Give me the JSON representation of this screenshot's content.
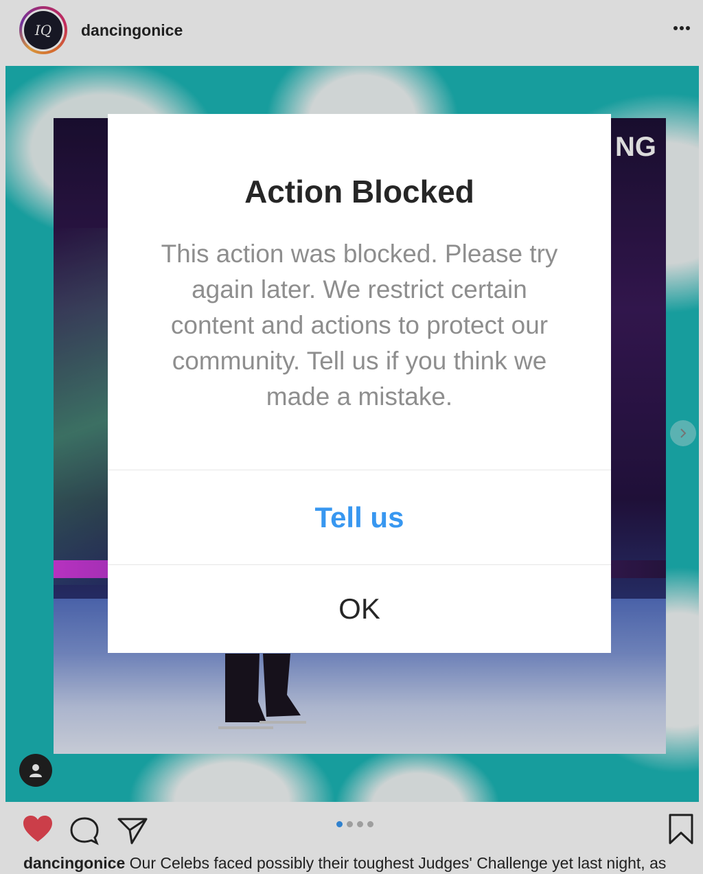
{
  "post": {
    "username": "dancingonice",
    "logo_text": "IQ",
    "photo_logo_text": "NG",
    "carousel": {
      "count": 4,
      "active_index": 0
    }
  },
  "caption": {
    "username": "dancingonice",
    "text": " Our Celebs faced possibly their toughest Judges' Challenge yet last night, as"
  },
  "modal": {
    "title": "Action Blocked",
    "body": "This action was blocked. Please try again later. We restrict certain content and actions to protect our community. Tell us if you think we made a mistake.",
    "tell_us_label": "Tell us",
    "ok_label": "OK"
  },
  "icons": {
    "more": "more-icon",
    "like": "heart-icon",
    "comment": "comment-icon",
    "share": "share-icon",
    "save": "bookmark-icon",
    "profile_tag": "user-icon",
    "next": "chevron-right-icon"
  },
  "colors": {
    "accent_blue": "#3897f0",
    "like_red": "#ed4956",
    "text_dark": "#262626",
    "text_muted": "#8e8e8e",
    "teal_background": "#1bb7b7"
  }
}
